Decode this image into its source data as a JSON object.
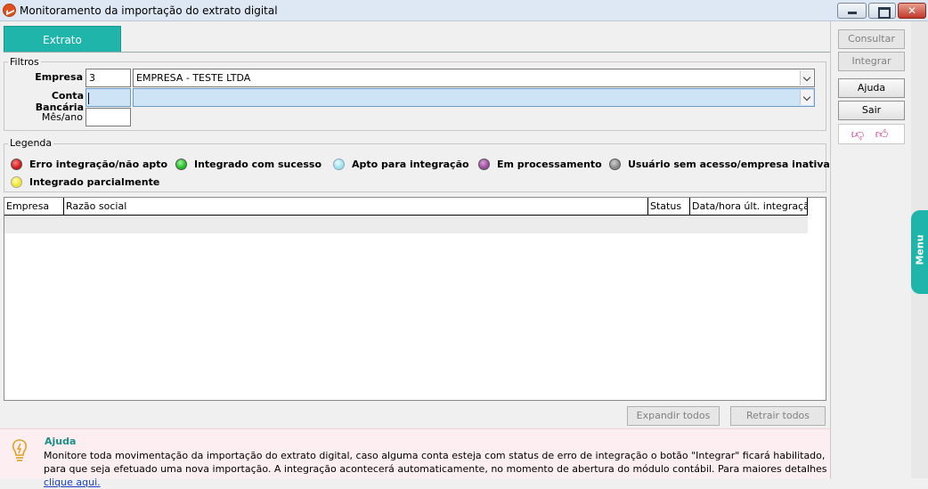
{
  "window": {
    "title": "Monitoramento da importação do extrato digital"
  },
  "tabs": [
    {
      "label": "Extrato",
      "active": true
    }
  ],
  "filters": {
    "group_label": "Filtros",
    "empresa": {
      "label": "Empresa",
      "code": "3",
      "name": "EMPRESA - TESTE LTDA"
    },
    "conta_bancaria": {
      "label": "Conta Bancária",
      "code": "",
      "name": ""
    },
    "mes_ano": {
      "label": "Mês/ano",
      "value": ""
    }
  },
  "legend": {
    "group_label": "Legenda",
    "items": [
      {
        "label": "Erro integração/não apto",
        "color": "#d01818"
      },
      {
        "label": "Integrado com sucesso",
        "color": "#1fbf1f"
      },
      {
        "label": "Apto para integração",
        "color": "#9fe0ee"
      },
      {
        "label": "Em processamento",
        "color": "#9b4a9b"
      },
      {
        "label": "Usuário sem acesso/empresa inativa",
        "color": "#8a8a8a"
      },
      {
        "label": "Integrado parcialmente",
        "color": "#f2e330"
      }
    ]
  },
  "grid": {
    "columns": [
      "Empresa",
      "Razão social",
      "Status",
      "Data/hora últ. integração"
    ]
  },
  "bottom_buttons": {
    "expandir": "Expandir todos",
    "retrair": "Retrair todos"
  },
  "side_buttons": {
    "consultar": "Consultar",
    "integrar": "Integrar",
    "ajuda": "Ajuda",
    "sair": "Sair"
  },
  "menu_tab": {
    "label": "Menu"
  },
  "help": {
    "title": "Ajuda",
    "text": "Monitore toda movimentação da importação do extrato digital, caso alguma conta esteja com status de erro de integração o botão \"Integrar\" ficará habilitado, para que seja efetuado uma nova importação. A integração acontecerá automaticamente, no momento de abertura do módulo contábil. Para maiores detalhes",
    "link": "clique aqui."
  }
}
